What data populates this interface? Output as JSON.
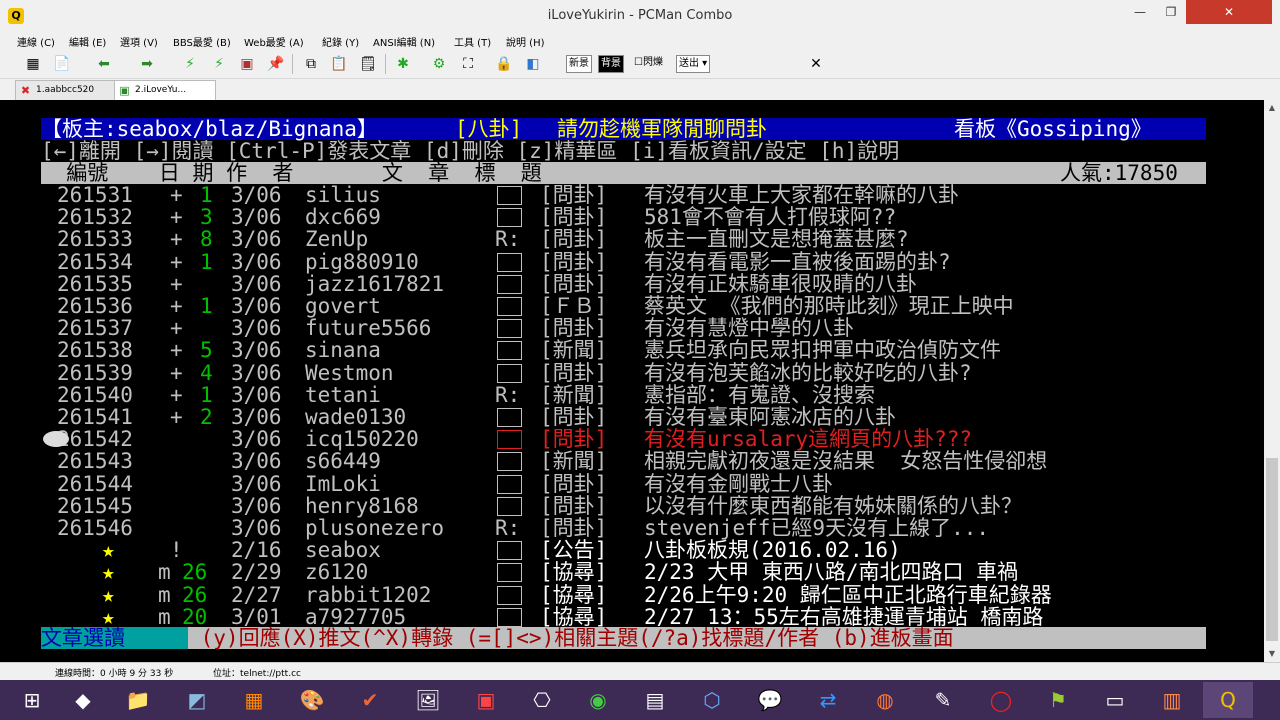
{
  "window": {
    "title": "iLoveYukirin - PCMan Combo"
  },
  "menu": [
    "連線 (C)",
    "編輯 (E)",
    "選項 (V)",
    "BBS最愛 (B)",
    "Web最愛 (A)",
    "紀錄 (Y)",
    "ANSI編輯 (N)",
    "工具 (T)",
    "說明 (H)"
  ],
  "toolbar": {
    "chip_new": "新景",
    "chip_bg": "背景",
    "chip_blink": "閃爍",
    "chip_send": "送出"
  },
  "tabs": [
    {
      "label": "1.aabbcc520"
    },
    {
      "label": "2.iLoveYu..."
    }
  ],
  "board": {
    "header_left": "【板主:seabox/blaz/Bignana】",
    "header_category": "[八卦]",
    "header_desc": "請勿趁機軍隊閒聊問卦",
    "header_right": "看板《Gossiping》",
    "help_line": "[←]離開 [→]閱讀 [Ctrl-P]發表文章 [d]刪除 [z]精華區 [i]看板資訊/設定 [h]說明",
    "col_header": "  編號    日 期 作  者       文  章  標  題",
    "popularity": "人氣:17850",
    "footer_label": "文章選讀",
    "footer_help": " (y)回應(X)推文(^X)轉錄 (=[]<>)相關主題(/?a)找標題/作者 (b)進板畫面"
  },
  "rows": [
    {
      "num": "261531",
      "flag": "+",
      "push": "1",
      "date": "3/06",
      "author": "silius",
      "mark": "",
      "cat": "[問卦]",
      "title": "有沒有火車上大家都在幹嘛的八卦"
    },
    {
      "num": "261532",
      "flag": "+",
      "push": "3",
      "date": "3/06",
      "author": "dxc669",
      "mark": "",
      "cat": "[問卦]",
      "title": "581會不會有人打假球阿??"
    },
    {
      "num": "261533",
      "flag": "+",
      "push": "8",
      "date": "3/06",
      "author": "ZenUp",
      "mark": "R:",
      "cat": "[問卦]",
      "title": "板主一直刪文是想掩蓋甚麼?"
    },
    {
      "num": "261534",
      "flag": "+",
      "push": "1",
      "date": "3/06",
      "author": "pig880910",
      "mark": "",
      "cat": "[問卦]",
      "title": "有沒有看電影一直被後面踢的卦?"
    },
    {
      "num": "261535",
      "flag": "+",
      "push": "",
      "date": "3/06",
      "author": "jazz1617821",
      "mark": "",
      "cat": "[問卦]",
      "title": "有沒有正妹騎車很吸睛的八卦"
    },
    {
      "num": "261536",
      "flag": "+",
      "push": "1",
      "date": "3/06",
      "author": "govert",
      "mark": "",
      "cat": "[ＦＢ]",
      "title": "蔡英文 《我們的那時此刻》現正上映中"
    },
    {
      "num": "261537",
      "flag": "+",
      "push": "",
      "date": "3/06",
      "author": "future5566",
      "mark": "",
      "cat": "[問卦]",
      "title": "有沒有慧燈中學的八卦"
    },
    {
      "num": "261538",
      "flag": "+",
      "push": "5",
      "date": "3/06",
      "author": "sinana",
      "mark": "",
      "cat": "[新聞]",
      "title": "憲兵坦承向民眾扣押軍中政治偵防文件"
    },
    {
      "num": "261539",
      "flag": "+",
      "push": "4",
      "date": "3/06",
      "author": "Westmon",
      "mark": "",
      "cat": "[問卦]",
      "title": "有沒有泡芙餡冰的比較好吃的八卦?"
    },
    {
      "num": "261540",
      "flag": "+",
      "push": "1",
      "date": "3/06",
      "author": "tetani",
      "mark": "R:",
      "cat": "[新聞]",
      "title": "憲指部：有蒐證、沒搜索"
    },
    {
      "num": "261541",
      "flag": "+",
      "push": "2",
      "date": "3/06",
      "author": "wade0130",
      "mark": "",
      "cat": "[問卦]",
      "title": "有沒有臺東阿憲冰店的八卦"
    },
    {
      "num": "261542",
      "flag": "",
      "push": "",
      "date": "3/06",
      "author": "icq150220",
      "mark": "",
      "cat": "[問卦]",
      "title": "有沒有ursalary這網頁的八卦???"
    },
    {
      "num": "261543",
      "flag": "",
      "push": "",
      "date": "3/06",
      "author": "s66449",
      "mark": "",
      "cat": "[新聞]",
      "title": "相親完獻初夜還是沒結果  女怒告性侵卻想"
    },
    {
      "num": "261544",
      "flag": "",
      "push": "",
      "date": "3/06",
      "author": "ImLoki",
      "mark": "",
      "cat": "[問卦]",
      "title": "有沒有金剛戰士八卦"
    },
    {
      "num": "261545",
      "flag": "",
      "push": "",
      "date": "3/06",
      "author": "henry8168",
      "mark": "",
      "cat": "[問卦]",
      "title": "以沒有什麼東西都能有姊妹關係的八卦？"
    },
    {
      "num": "261546",
      "flag": "",
      "push": "",
      "date": "3/06",
      "author": "plusonezero",
      "mark": "R:",
      "cat": "[問卦]",
      "title": "stevenjeff已經9天沒有上線了..."
    }
  ],
  "pinned": [
    {
      "star": "★",
      "flag": "!",
      "push": "",
      "date": "2/16",
      "author": "seabox",
      "cat": "[公告]",
      "title": "八卦板板規(2016.02.16)"
    },
    {
      "star": "★",
      "flag": "m",
      "push": "26",
      "date": "2/29",
      "author": "z6120",
      "cat": "[協尋]",
      "title": "2/23 大甲 東西八路/南北四路口 車禍"
    },
    {
      "star": "★",
      "flag": "m",
      "push": "26",
      "date": "2/27",
      "author": "rabbit1202",
      "cat": "[協尋]",
      "title": "2/26上午9:20 歸仁區中正北路行車紀錄器"
    },
    {
      "star": "★",
      "flag": "m",
      "push": "20",
      "date": "3/01",
      "author": "a7927705",
      "cat": "[協尋]",
      "title": "2/27 13：55左右高雄捷運青埔站 橋南路"
    }
  ],
  "status": {
    "conn_time": "連線時間：0 小時 9 分 33 秒",
    "address": "位址：telnet://ptt.cc"
  },
  "colors": {
    "terminal_bg": "#000000",
    "header_bg": "#0000b0",
    "highlight_red": "#e02020",
    "taskbar": "#3d2a55"
  }
}
